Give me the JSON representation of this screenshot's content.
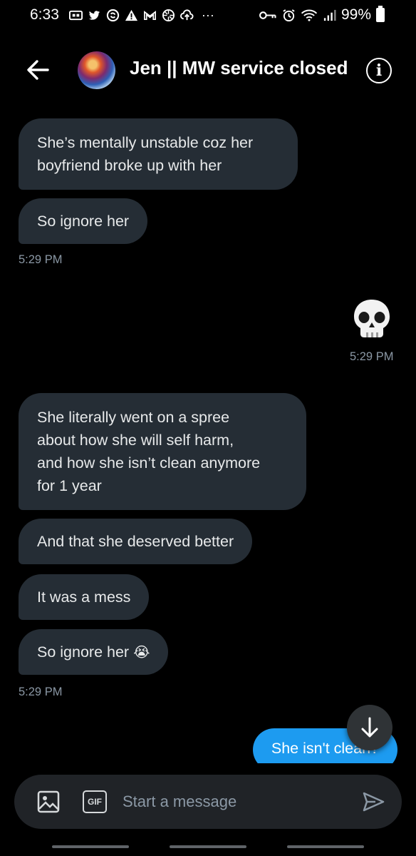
{
  "status_bar": {
    "time": "6:33",
    "battery": "99%"
  },
  "header": {
    "title": "Jen || MW service closed",
    "info_glyph": "i",
    "back_icon": "arrow-left-icon",
    "info_icon": "info-circle-icon"
  },
  "messages": [
    {
      "side": "received",
      "text_lines": [
        "She’s mentally unstable coz her",
        "boyfriend broke up with her"
      ]
    },
    {
      "side": "received",
      "text": "So ignore her"
    },
    {
      "side": "received",
      "text_lines": [
        "She literally went on a spree",
        "about how she will self harm,",
        "and how she isn’t clean anymore",
        "for 1 year"
      ]
    },
    {
      "side": "received",
      "text": "And that she deserved better"
    },
    {
      "side": "received",
      "text": "It was a mess"
    },
    {
      "side": "received",
      "text": "So ignore her",
      "emoji": "😭"
    },
    {
      "side": "sent",
      "text": "She isn't clean?"
    }
  ],
  "timestamps": {
    "t1": "5:29 PM",
    "t2": "5:29 PM",
    "t3": "5:29 PM"
  },
  "sent_emoji_icon": "skull-icon",
  "composer": {
    "placeholder": "Start a message",
    "gif_label": "GIF",
    "image_icon": "image-icon",
    "send_icon": "send-icon"
  },
  "colors": {
    "background": "#000000",
    "received_bubble": "#252d35",
    "sent_bubble": "#1d9bf0",
    "timestamp": "#8b98a5"
  }
}
